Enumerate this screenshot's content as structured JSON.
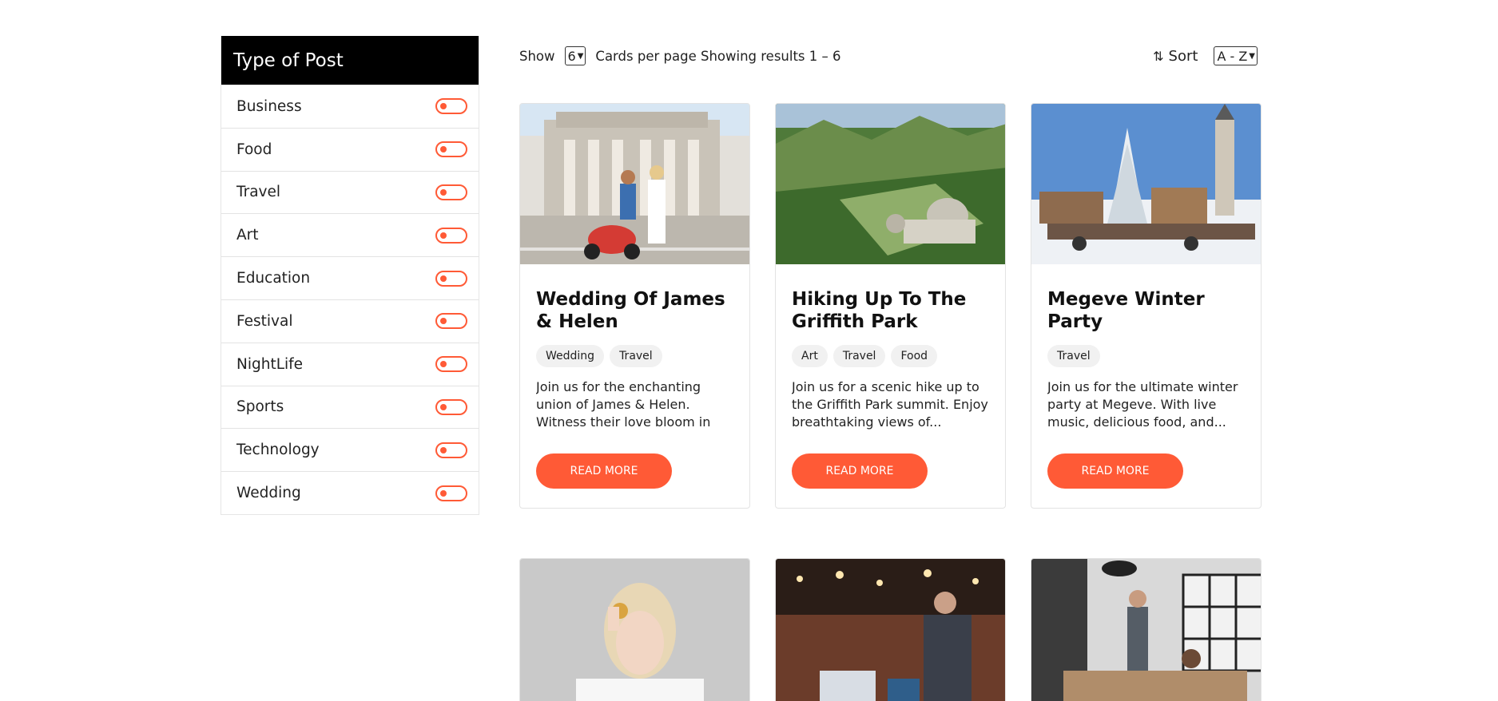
{
  "sidebar": {
    "title": "Type of Post",
    "items": [
      {
        "label": "Business"
      },
      {
        "label": "Food"
      },
      {
        "label": "Travel"
      },
      {
        "label": "Art"
      },
      {
        "label": "Education"
      },
      {
        "label": "Festival"
      },
      {
        "label": "NightLife"
      },
      {
        "label": "Sports"
      },
      {
        "label": "Technology"
      },
      {
        "label": "Wedding"
      }
    ]
  },
  "toolbar": {
    "show_label": "Show",
    "per_page_value": "6",
    "per_page_text": "Cards per page Showing results 1 – 6",
    "sort_label": "Sort",
    "sort_value": "A - Z"
  },
  "cards": [
    {
      "title": "Wedding Of James & Helen",
      "tags": [
        "Wedding",
        "Travel"
      ],
      "description": "Join us for the enchanting union of James & Helen. Witness their love bloom in a...",
      "button": "READ MORE"
    },
    {
      "title": "Hiking Up To The Griffith Park",
      "tags": [
        "Art",
        "Travel",
        "Food"
      ],
      "description": "Join us for a scenic hike up to the Griffith Park summit. Enjoy breathtaking views of...",
      "button": "READ MORE"
    },
    {
      "title": "Megeve Winter Party",
      "tags": [
        "Travel"
      ],
      "description": "Join us for the ultimate winter party at Megeve. With live music, delicious food, and...",
      "button": "READ MORE"
    }
  ],
  "colors": {
    "accent": "#ff5a36",
    "header_bg": "#000000"
  }
}
